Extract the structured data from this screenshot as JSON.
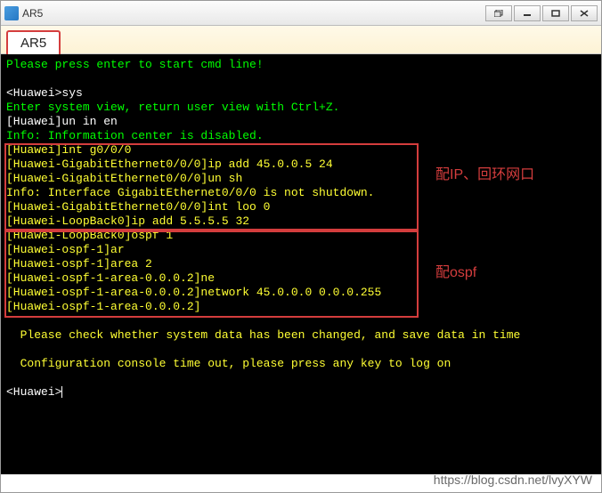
{
  "window": {
    "title": "AR5"
  },
  "tabs": [
    {
      "label": "AR5",
      "active": true
    }
  ],
  "terminal": {
    "lines": [
      {
        "text": "Please press enter to start cmd line!",
        "cls": ""
      },
      {
        "text": "",
        "cls": ""
      },
      {
        "text": "<Huawei>sys",
        "cls": "white"
      },
      {
        "text": "Enter system view, return user view with Ctrl+Z.",
        "cls": ""
      },
      {
        "text": "[Huawei]un in en",
        "cls": "white"
      },
      {
        "text": "Info: Information center is disabled.",
        "cls": ""
      },
      {
        "text": "[Huawei]int g0/0/0",
        "cls": "yellow"
      },
      {
        "text": "[Huawei-GigabitEthernet0/0/0]ip add 45.0.0.5 24",
        "cls": "yellow"
      },
      {
        "text": "[Huawei-GigabitEthernet0/0/0]un sh",
        "cls": "yellow"
      },
      {
        "text": "Info: Interface GigabitEthernet0/0/0 is not shutdown.",
        "cls": "yellow"
      },
      {
        "text": "[Huawei-GigabitEthernet0/0/0]int loo 0",
        "cls": "yellow"
      },
      {
        "text": "[Huawei-LoopBack0]ip add 5.5.5.5 32",
        "cls": "yellow"
      },
      {
        "text": "[Huawei-LoopBack0]ospf 1",
        "cls": "yellow"
      },
      {
        "text": "[Huawei-ospf-1]ar",
        "cls": "yellow"
      },
      {
        "text": "[Huawei-ospf-1]area 2",
        "cls": "yellow"
      },
      {
        "text": "[Huawei-ospf-1-area-0.0.0.2]ne",
        "cls": "yellow"
      },
      {
        "text": "[Huawei-ospf-1-area-0.0.0.2]network 45.0.0.0 0.0.0.255",
        "cls": "yellow"
      },
      {
        "text": "[Huawei-ospf-1-area-0.0.0.2]",
        "cls": "yellow"
      },
      {
        "text": "",
        "cls": ""
      },
      {
        "text": "  Please check whether system data has been changed, and save data in time",
        "cls": "yellow"
      },
      {
        "text": "",
        "cls": ""
      },
      {
        "text": "  Configuration console time out, please press any key to log on",
        "cls": "yellow"
      },
      {
        "text": "",
        "cls": ""
      },
      {
        "text": "<Huawei>",
        "cls": "white",
        "cursor": true
      }
    ]
  },
  "annotations": {
    "box1_label": "配IP、回环网口",
    "box2_label": "配ospf"
  },
  "watermark": "https://blog.csdn.net/lvyXYW"
}
